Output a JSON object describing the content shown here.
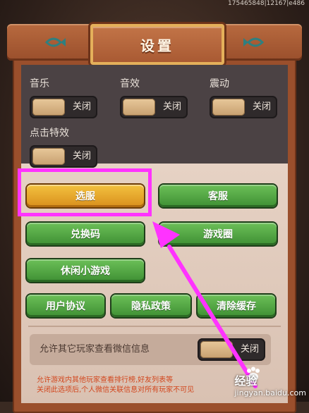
{
  "corner_code": "175465848|12167|e486",
  "title": "设置",
  "settings": {
    "music": {
      "label": "音乐",
      "toggle": "关闭"
    },
    "sound": {
      "label": "音效",
      "toggle": "关闭"
    },
    "vibration": {
      "label": "震动",
      "toggle": "关闭"
    },
    "click_effect": {
      "label": "点击特效",
      "toggle": "关闭"
    }
  },
  "buttons": {
    "select_server": "选服",
    "customer_service": "客服",
    "redeem_code": "兑换码",
    "game_circle": "游戏圈",
    "casual_games": "休闲小游戏",
    "user_agreement": "用户协议",
    "privacy_policy": "隐私政策",
    "clear_cache": "清除缓存"
  },
  "permission": {
    "label": "允许其它玩家查看微信信息",
    "toggle": "关闭"
  },
  "notes": {
    "line1": "允许游戏内其他玩家查看排行榜,好友列表等",
    "line2": "关闭此选项后,个人微信关联信息对所有玩家不可见"
  },
  "watermark": {
    "brand": "经验",
    "url": "jingyan.baidu.com"
  },
  "colors": {
    "highlight": "#ff33ff",
    "arrow": "#ff33ff",
    "green_button": "#4fa63f",
    "orange_button": "#e8a82c"
  }
}
